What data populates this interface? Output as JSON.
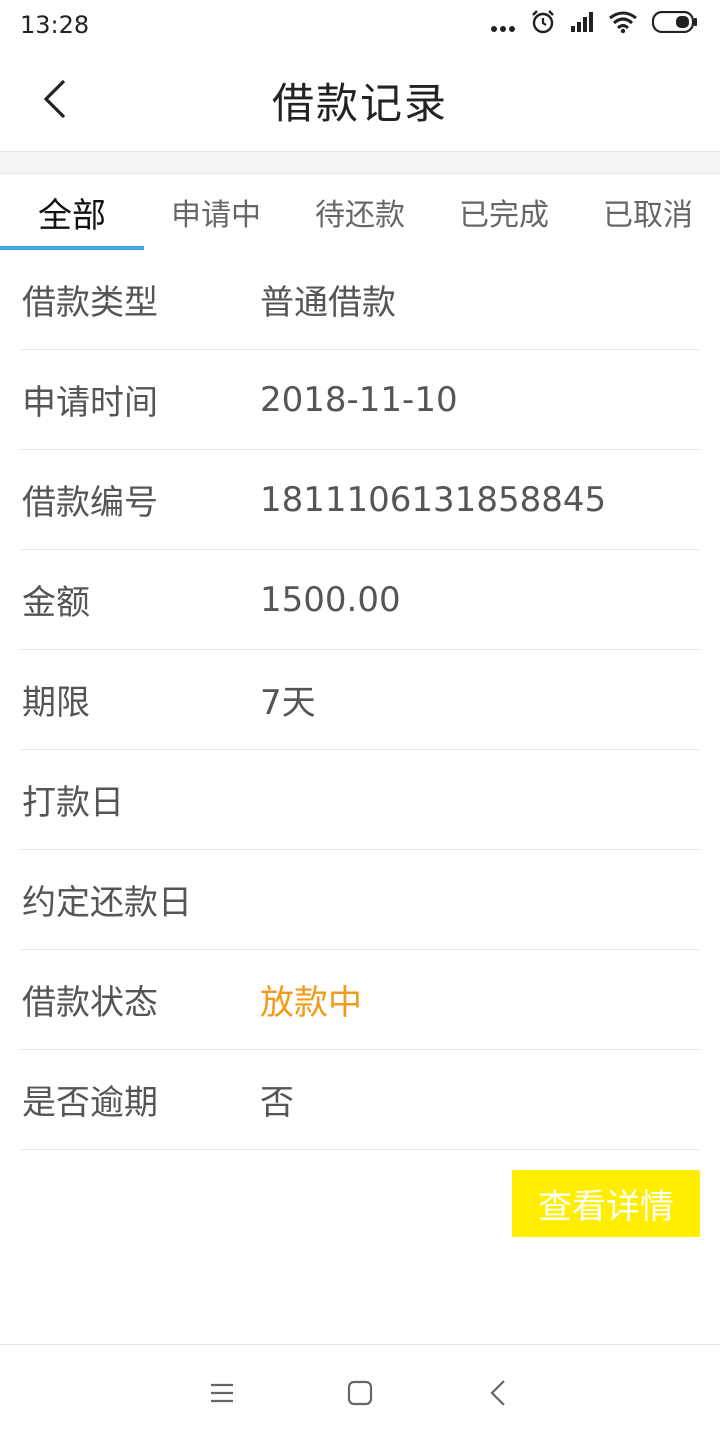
{
  "status_bar": {
    "time": "13:28"
  },
  "header": {
    "title": "借款记录"
  },
  "tabs": [
    {
      "label": "全部",
      "active": true
    },
    {
      "label": "申请中",
      "active": false
    },
    {
      "label": "待还款",
      "active": false
    },
    {
      "label": "已完成",
      "active": false
    },
    {
      "label": "已取消",
      "active": false
    }
  ],
  "record": {
    "rows": [
      {
        "label": "借款类型",
        "value": "普通借款"
      },
      {
        "label": "申请时间",
        "value": "2018-11-10"
      },
      {
        "label": "借款编号",
        "value": "1811106131858845"
      },
      {
        "label": "金额",
        "value": "1500.00"
      },
      {
        "label": "期限",
        "value": "7天"
      },
      {
        "label": "打款日",
        "value": ""
      },
      {
        "label": "约定还款日",
        "value": ""
      },
      {
        "label": "借款状态",
        "value": "放款中"
      },
      {
        "label": "是否逾期",
        "value": "否"
      }
    ],
    "detail_button": "查看详情"
  },
  "colors": {
    "accent_tab": "#3ea6e6",
    "status_pending": "#f09b1c",
    "detail_button_bg": "#ffee00"
  },
  "icons": {
    "back": "chevron-left-icon",
    "status": [
      "more-dots-icon",
      "alarm-icon",
      "signal-icon",
      "wifi-icon",
      "battery-icon"
    ],
    "nav": [
      "menu-icon",
      "home-square-icon",
      "back-triangle-icon"
    ]
  }
}
